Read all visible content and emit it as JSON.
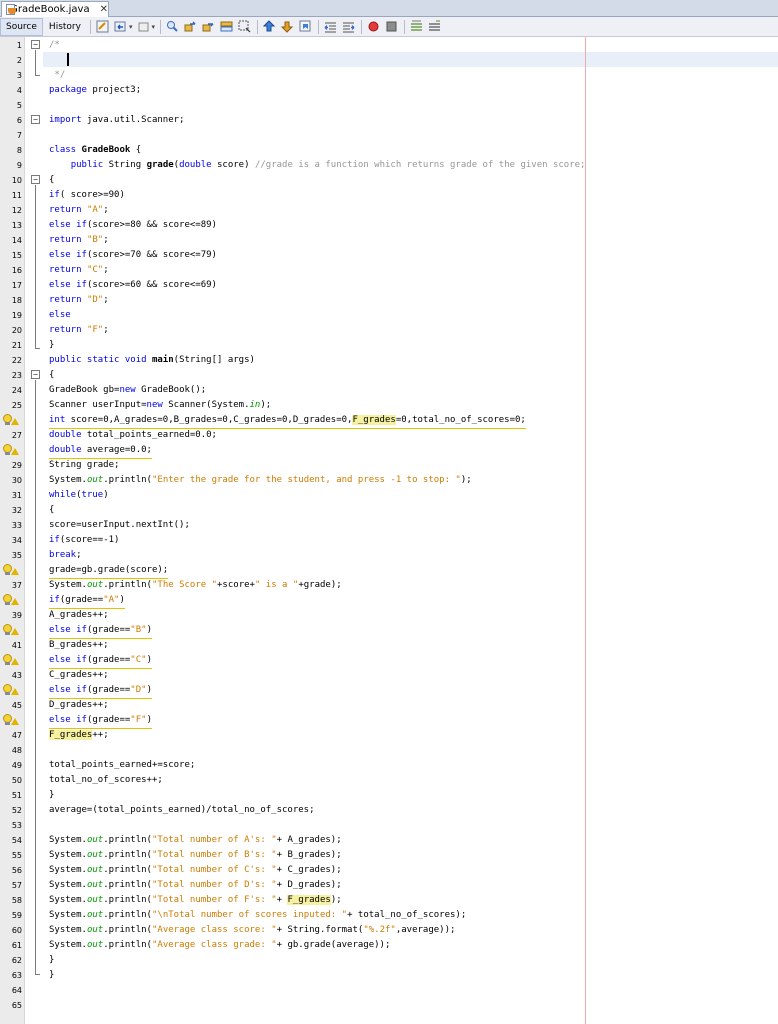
{
  "tab": {
    "title": "GradeBook.java",
    "close": "✕"
  },
  "toolbar": {
    "source_label": "Source",
    "history_label": "History"
  },
  "lines": [
    {
      "n": "1",
      "t": [
        [
          "cm",
          "/*"
        ]
      ]
    },
    {
      "n": "2",
      "t": []
    },
    {
      "n": "3",
      "t": [
        [
          "cm",
          " */"
        ]
      ]
    },
    {
      "n": "4",
      "t": [
        [
          "kw",
          "package"
        ],
        [
          "",
          " project3;"
        ]
      ]
    },
    {
      "n": "5",
      "t": []
    },
    {
      "n": "6",
      "t": [
        [
          "kw",
          "import"
        ],
        [
          "",
          " java.util.Scanner;"
        ]
      ]
    },
    {
      "n": "7",
      "t": []
    },
    {
      "n": "8",
      "t": [
        [
          "kw",
          "class"
        ],
        [
          "bold",
          " GradeBook"
        ],
        [
          "",
          " {"
        ]
      ]
    },
    {
      "n": "9",
      "t": [
        [
          "",
          "    "
        ],
        [
          "kw",
          "public"
        ],
        [
          "",
          " String "
        ],
        [
          "bold",
          "grade"
        ],
        [
          "",
          "("
        ],
        [
          "kw",
          "double"
        ],
        [
          "",
          " score) "
        ],
        [
          "cm",
          "//grade is a function which returns grade of the given score;"
        ]
      ]
    },
    {
      "n": "10",
      "t": [
        [
          "",
          "{"
        ]
      ]
    },
    {
      "n": "11",
      "t": [
        [
          "kw",
          "if"
        ],
        [
          "",
          "( score>=90)"
        ]
      ]
    },
    {
      "n": "12",
      "t": [
        [
          "kw",
          "return"
        ],
        [
          "",
          " "
        ],
        [
          "str",
          "\"A\""
        ],
        [
          "",
          ";"
        ]
      ]
    },
    {
      "n": "13",
      "t": [
        [
          "kw",
          "else if"
        ],
        [
          "",
          "(score>=80 && score<=89)"
        ]
      ]
    },
    {
      "n": "14",
      "t": [
        [
          "kw",
          "return"
        ],
        [
          "",
          " "
        ],
        [
          "str",
          "\"B\""
        ],
        [
          "",
          ";"
        ]
      ]
    },
    {
      "n": "15",
      "t": [
        [
          "kw",
          "else if"
        ],
        [
          "",
          "(score>=70 && score<=79)"
        ]
      ]
    },
    {
      "n": "16",
      "t": [
        [
          "kw",
          "return"
        ],
        [
          "",
          " "
        ],
        [
          "str",
          "\"C\""
        ],
        [
          "",
          ";"
        ]
      ]
    },
    {
      "n": "17",
      "t": [
        [
          "kw",
          "else if"
        ],
        [
          "",
          "(score>=60 && score<=69)"
        ]
      ]
    },
    {
      "n": "18",
      "t": [
        [
          "kw",
          "return"
        ],
        [
          "",
          " "
        ],
        [
          "str",
          "\"D\""
        ],
        [
          "",
          ";"
        ]
      ]
    },
    {
      "n": "19",
      "t": [
        [
          "kw",
          "else"
        ]
      ]
    },
    {
      "n": "20",
      "t": [
        [
          "kw",
          "return"
        ],
        [
          "",
          " "
        ],
        [
          "str",
          "\"F\""
        ],
        [
          "",
          ";"
        ]
      ]
    },
    {
      "n": "21",
      "t": [
        [
          "",
          "}"
        ]
      ]
    },
    {
      "n": "22",
      "t": [
        [
          "kw",
          "public static void"
        ],
        [
          "",
          " "
        ],
        [
          "bold",
          "main"
        ],
        [
          "",
          "(String[] args)"
        ]
      ]
    },
    {
      "n": "23",
      "t": [
        [
          "",
          "{"
        ]
      ]
    },
    {
      "n": "24",
      "t": [
        [
          "",
          "GradeBook gb="
        ],
        [
          "kw",
          "new"
        ],
        [
          "",
          " GradeBook();"
        ]
      ]
    },
    {
      "n": "25",
      "t": [
        [
          "",
          "Scanner userInput="
        ],
        [
          "kw",
          "new"
        ],
        [
          "",
          " Scanner(System."
        ],
        [
          "fld",
          "in"
        ],
        [
          "",
          ");"
        ]
      ]
    },
    {
      "n": "26",
      "hint": true,
      "t": [
        [
          "kw",
          "int"
        ],
        [
          "",
          " score=0,A_grades=0,B_grades=0,C_grades=0,D_grades=0,"
        ],
        [
          "hl",
          "F_grades"
        ],
        [
          "",
          "=0,total_no_of_scores=0;"
        ]
      ],
      "u": true
    },
    {
      "n": "27",
      "t": [
        [
          "kw",
          "double"
        ],
        [
          "",
          " total_points_earned=0.0;"
        ]
      ]
    },
    {
      "n": "28",
      "hint": true,
      "t": [
        [
          "kw",
          "double"
        ],
        [
          "",
          " average=0.0;"
        ]
      ],
      "u": true
    },
    {
      "n": "29",
      "t": [
        [
          "",
          "String grade;"
        ]
      ]
    },
    {
      "n": "30",
      "t": [
        [
          "",
          "System."
        ],
        [
          "fld",
          "out"
        ],
        [
          "",
          ".println("
        ],
        [
          "str",
          "\"Enter the grade for the student, and press -1 to stop: \""
        ],
        [
          "",
          ");"
        ]
      ]
    },
    {
      "n": "31",
      "t": [
        [
          "kw",
          "while"
        ],
        [
          "",
          "("
        ],
        [
          "kw",
          "true"
        ],
        [
          "",
          ")"
        ]
      ]
    },
    {
      "n": "32",
      "t": [
        [
          "",
          "{"
        ]
      ]
    },
    {
      "n": "33",
      "t": [
        [
          "",
          "score=userInput.nextInt();"
        ]
      ]
    },
    {
      "n": "34",
      "t": [
        [
          "kw",
          "if"
        ],
        [
          "",
          "(score==-1)"
        ]
      ]
    },
    {
      "n": "35",
      "t": [
        [
          "kw",
          "break"
        ],
        [
          "",
          ";"
        ]
      ]
    },
    {
      "n": "36",
      "hint": true,
      "t": [
        [
          "",
          "grade=gb.grade(score);"
        ]
      ],
      "u": true
    },
    {
      "n": "37",
      "t": [
        [
          "",
          "System."
        ],
        [
          "fld",
          "out"
        ],
        [
          "",
          ".println("
        ],
        [
          "str",
          "\"The Score \""
        ],
        [
          "",
          "+score+"
        ],
        [
          "str",
          "\" is a \""
        ],
        [
          "",
          "+grade);"
        ]
      ]
    },
    {
      "n": "38",
      "hint": true,
      "t": [
        [
          "kw",
          "if"
        ],
        [
          "",
          "(grade=="
        ],
        [
          "str",
          "\"A\""
        ],
        [
          "",
          ")"
        ]
      ],
      "u": true
    },
    {
      "n": "39",
      "t": [
        [
          "",
          "A_grades++;"
        ]
      ]
    },
    {
      "n": "40",
      "hint": true,
      "t": [
        [
          "kw",
          "else if"
        ],
        [
          "",
          "(grade=="
        ],
        [
          "str",
          "\"B\""
        ],
        [
          "",
          ")"
        ]
      ],
      "u": true
    },
    {
      "n": "41",
      "t": [
        [
          "",
          "B_grades++;"
        ]
      ]
    },
    {
      "n": "42",
      "hint": true,
      "t": [
        [
          "kw",
          "else if"
        ],
        [
          "",
          "(grade=="
        ],
        [
          "str",
          "\"C\""
        ],
        [
          "",
          ")"
        ]
      ],
      "u": true
    },
    {
      "n": "43",
      "t": [
        [
          "",
          "C_grades++;"
        ]
      ]
    },
    {
      "n": "44",
      "hint": true,
      "t": [
        [
          "kw",
          "else if"
        ],
        [
          "",
          "(grade=="
        ],
        [
          "str",
          "\"D\""
        ],
        [
          "",
          ")"
        ]
      ],
      "u": true
    },
    {
      "n": "45",
      "t": [
        [
          "",
          "D_grades++;"
        ]
      ]
    },
    {
      "n": "46",
      "hint": true,
      "t": [
        [
          "kw",
          "else if"
        ],
        [
          "",
          "(grade=="
        ],
        [
          "str",
          "\"F\""
        ],
        [
          "",
          ")"
        ]
      ],
      "u": true
    },
    {
      "n": "47",
      "t": [
        [
          "hl",
          "F_grades"
        ],
        [
          "",
          "++;"
        ]
      ]
    },
    {
      "n": "48",
      "t": []
    },
    {
      "n": "49",
      "t": [
        [
          "",
          "total_points_earned+=score;"
        ]
      ]
    },
    {
      "n": "50",
      "t": [
        [
          "",
          "total_no_of_scores++;"
        ]
      ]
    },
    {
      "n": "51",
      "t": [
        [
          "",
          "}"
        ]
      ]
    },
    {
      "n": "52",
      "t": [
        [
          "",
          "average=(total_points_earned)/total_no_of_scores;"
        ]
      ]
    },
    {
      "n": "53",
      "t": []
    },
    {
      "n": "54",
      "t": [
        [
          "",
          "System."
        ],
        [
          "fld",
          "out"
        ],
        [
          "",
          ".println("
        ],
        [
          "str",
          "\"Total number of A's: \""
        ],
        [
          "",
          "+ A_grades);"
        ]
      ]
    },
    {
      "n": "55",
      "t": [
        [
          "",
          "System."
        ],
        [
          "fld",
          "out"
        ],
        [
          "",
          ".println("
        ],
        [
          "str",
          "\"Total number of B's: \""
        ],
        [
          "",
          "+ B_grades);"
        ]
      ]
    },
    {
      "n": "56",
      "t": [
        [
          "",
          "System."
        ],
        [
          "fld",
          "out"
        ],
        [
          "",
          ".println("
        ],
        [
          "str",
          "\"Total number of C's: \""
        ],
        [
          "",
          "+ C_grades);"
        ]
      ]
    },
    {
      "n": "57",
      "t": [
        [
          "",
          "System."
        ],
        [
          "fld",
          "out"
        ],
        [
          "",
          ".println("
        ],
        [
          "str",
          "\"Total number of D's: \""
        ],
        [
          "",
          "+ D_grades);"
        ]
      ]
    },
    {
      "n": "58",
      "t": [
        [
          "",
          "System."
        ],
        [
          "fld",
          "out"
        ],
        [
          "",
          ".println("
        ],
        [
          "str",
          "\"Total number of F's: \""
        ],
        [
          "",
          "+ "
        ],
        [
          "hl",
          "F_grades"
        ],
        [
          "",
          ");"
        ]
      ]
    },
    {
      "n": "59",
      "t": [
        [
          "",
          "System."
        ],
        [
          "fld",
          "out"
        ],
        [
          "",
          ".println("
        ],
        [
          "str",
          "\"\\nTotal number of scores inputed: \""
        ],
        [
          "",
          "+ total_no_of_scores);"
        ]
      ]
    },
    {
      "n": "60",
      "t": [
        [
          "",
          "System."
        ],
        [
          "fld",
          "out"
        ],
        [
          "",
          ".println("
        ],
        [
          "str",
          "\"Average class score: \""
        ],
        [
          "",
          "+ String.format("
        ],
        [
          "str",
          "\"%.2f\""
        ],
        [
          "",
          ",average));"
        ]
      ]
    },
    {
      "n": "61",
      "t": [
        [
          "",
          "System."
        ],
        [
          "fld",
          "out"
        ],
        [
          "",
          ".println("
        ],
        [
          "str",
          "\"Average class grade: \""
        ],
        [
          "",
          "+ gb.grade(average));"
        ]
      ]
    },
    {
      "n": "62",
      "t": [
        [
          "",
          "}"
        ]
      ]
    },
    {
      "n": "63",
      "t": [
        [
          "",
          "}"
        ]
      ]
    },
    {
      "n": "64",
      "t": []
    },
    {
      "n": "65",
      "t": []
    }
  ]
}
